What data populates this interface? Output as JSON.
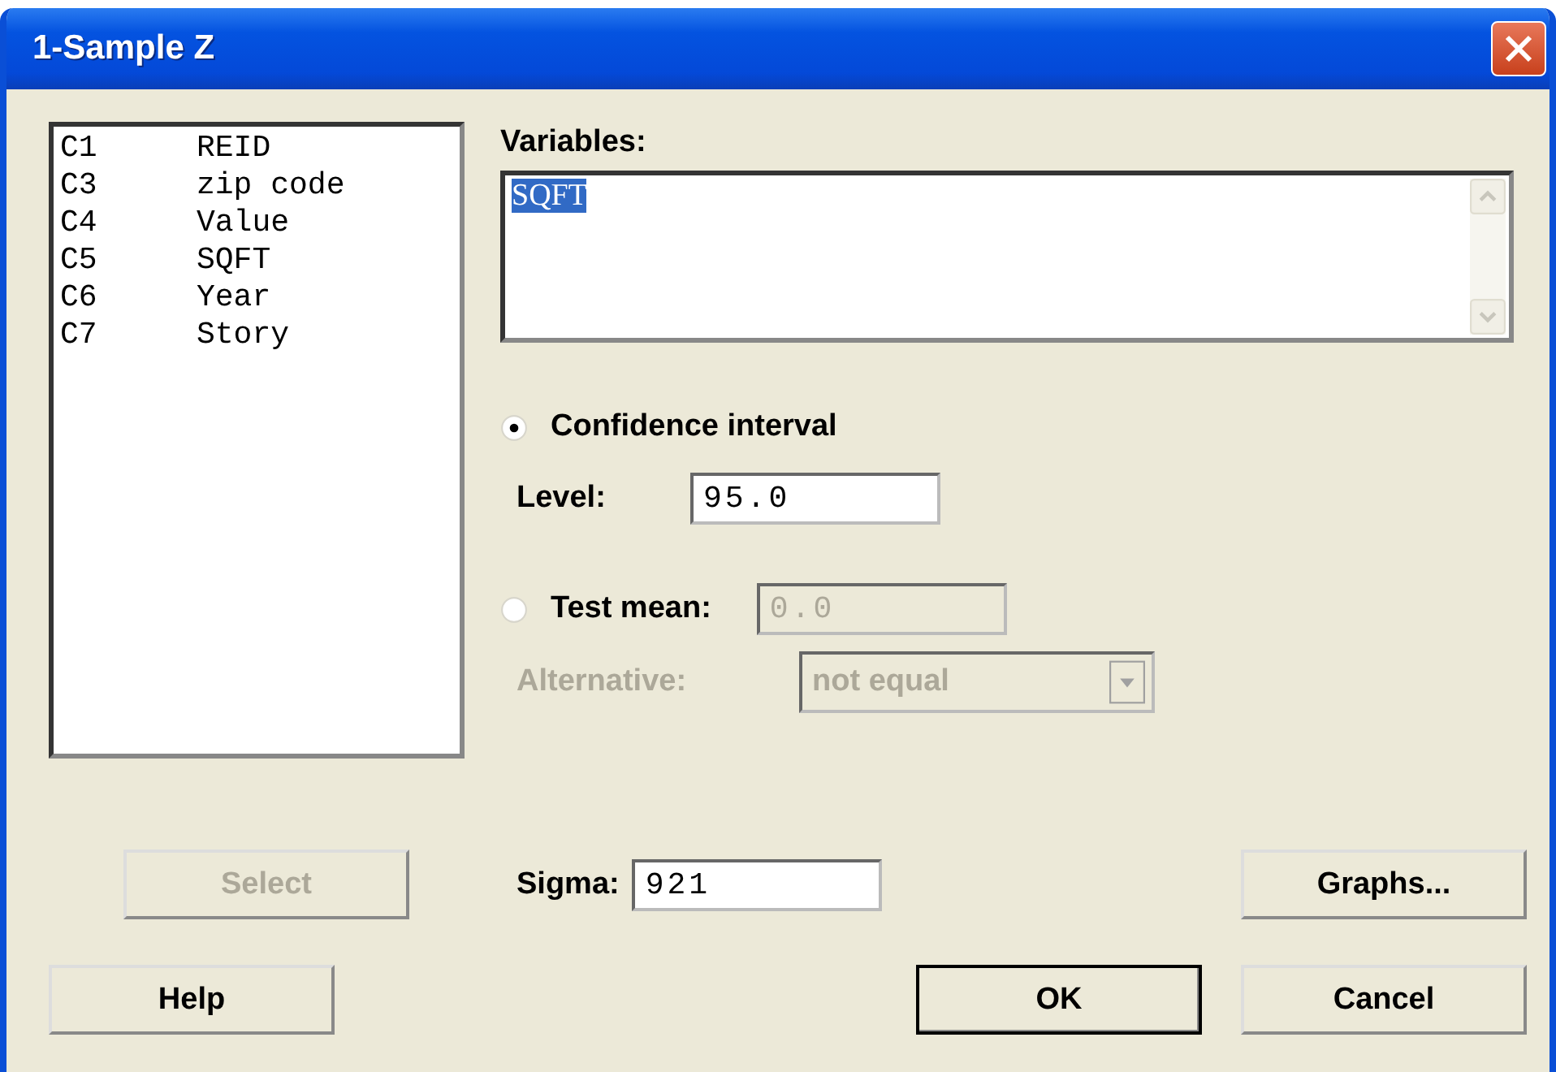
{
  "window": {
    "title": "1-Sample Z"
  },
  "columns_list": [
    {
      "id": "C1",
      "name": "REID"
    },
    {
      "id": "C3",
      "name": "zip code"
    },
    {
      "id": "C4",
      "name": "Value"
    },
    {
      "id": "C5",
      "name": "SQFT"
    },
    {
      "id": "C6",
      "name": "Year"
    },
    {
      "id": "C7",
      "name": "Story"
    }
  ],
  "variables": {
    "label": "Variables:",
    "value": "SQFT"
  },
  "options": [
    {
      "label": "Confidence interval",
      "selected": true,
      "field_label": "Level:",
      "field_value": "95.0",
      "disabled": false
    },
    {
      "label": "Test mean:",
      "selected": false,
      "field_value": "0.0",
      "disabled": true
    }
  ],
  "alternative": {
    "label": "Alternative:",
    "value": "not equal",
    "disabled": true
  },
  "select_button": {
    "label": "Select",
    "disabled": true
  },
  "sigma": {
    "label": "Sigma:",
    "value": "921"
  },
  "buttons": [
    {
      "label": "Graphs...",
      "kind": "side",
      "default": false
    },
    {
      "label": "Help",
      "kind": "left",
      "default": false
    },
    {
      "label": "OK",
      "kind": "main",
      "default": true
    },
    {
      "label": "Cancel",
      "kind": "main",
      "default": false
    }
  ]
}
